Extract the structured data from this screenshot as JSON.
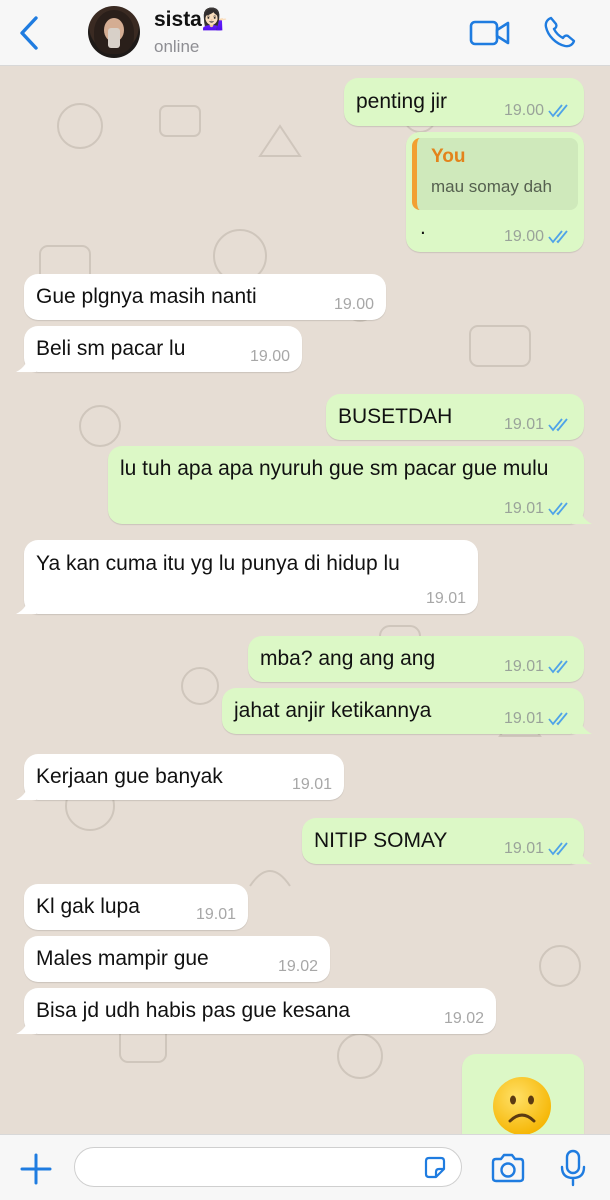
{
  "header": {
    "contact_name": "sista💁🏻‍♀️",
    "status": "online",
    "icons": [
      "back-chevron-icon",
      "video-call-icon",
      "phone-call-icon"
    ]
  },
  "colors": {
    "accent": "#1f7ce0",
    "incoming_bubble": "#ffffff",
    "outgoing_bubble": "#dcf8c6",
    "read_ticks": "#4fa3e8",
    "quote_bar": "#f29f32"
  },
  "messages": [
    {
      "dir": "out",
      "text": "penting jir",
      "time": "19.00",
      "read": true
    },
    {
      "dir": "out",
      "quote_author": "You",
      "quote_text": "mau somay dah",
      "text": ".",
      "time": "19.00",
      "read": true
    },
    {
      "dir": "in",
      "text": "Gue plgnya masih nanti",
      "time": "19.00"
    },
    {
      "dir": "in",
      "text": "Beli sm pacar lu",
      "time": "19.00"
    },
    {
      "dir": "out",
      "text": "BUSETDAH",
      "time": "19.01",
      "read": true
    },
    {
      "dir": "out",
      "text": "lu tuh apa apa nyuruh gue sm pacar gue mulu",
      "time": "19.01",
      "read": true
    },
    {
      "dir": "in",
      "text": "Ya kan cuma itu yg lu punya di hidup lu",
      "time": "19.01"
    },
    {
      "dir": "out",
      "text": "mba? ang ang ang",
      "time": "19.01",
      "read": true
    },
    {
      "dir": "out",
      "text": "jahat anjir ketikannya",
      "time": "19.01",
      "read": true
    },
    {
      "dir": "in",
      "text": "Kerjaan gue banyak",
      "time": "19.01"
    },
    {
      "dir": "out",
      "text": "NITIP SOMAY",
      "time": "19.01",
      "read": true
    },
    {
      "dir": "in",
      "text": "Kl gak lupa",
      "time": "19.01"
    },
    {
      "dir": "in",
      "text": "Males mampir gue",
      "time": "19.02"
    },
    {
      "dir": "in",
      "text": "Bisa jd udh habis pas gue kesana",
      "time": "19.02"
    },
    {
      "dir": "out",
      "emoji": "frowning-face-emoji"
    }
  ],
  "input": {
    "value": "",
    "placeholder": "",
    "icons": [
      "plus-icon",
      "sticker-icon",
      "camera-icon",
      "microphone-icon"
    ]
  }
}
